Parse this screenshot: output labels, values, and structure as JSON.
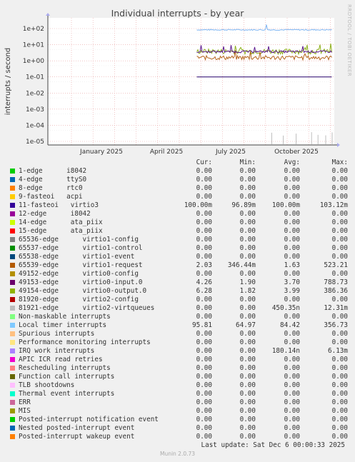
{
  "chart_data": {
    "type": "line",
    "title": "Individual interrupts - by year",
    "ylabel": "interrupts / second",
    "yscale": "log",
    "ylim": [
      1e-05,
      200
    ],
    "y_ticks": [
      "1e+02",
      "1e+01",
      "1e+00",
      "1e-01",
      "1e-02",
      "1e-03",
      "1e-04",
      "1e-05"
    ],
    "x_ticks": [
      "January 2025",
      "April 2025",
      "July 2025",
      "October 2025"
    ],
    "grid": true,
    "series": [
      {
        "name": "Local timer interrupts",
        "color": "#7eb5f2",
        "level": 84,
        "jitter": 0.08,
        "start": 0.52
      },
      {
        "name": "virtio0-output.0",
        "color": "#8db01b",
        "level": 4.0,
        "jitter": 0.35,
        "start": 0.52
      },
      {
        "name": "virtio1-request",
        "color": "#b5651d",
        "level": 1.6,
        "jitter": 0.3,
        "start": 0.52
      },
      {
        "name": "virtio0-input.0",
        "color": "#5c1a8c",
        "level": 3.7,
        "jitter": 0.15,
        "start": 0.52
      },
      {
        "name": "virtio3",
        "color": "#24006d",
        "level": 0.1,
        "jitter": 0.0,
        "start": 0.52
      }
    ],
    "spikes": [
      0.63,
      0.72,
      0.82,
      0.94,
      0.99,
      1.05,
      1.1,
      1.12
    ]
  },
  "side_label": "RRDTOOL / TOBI OETIKER",
  "legend": {
    "headers": {
      "cur": "Cur:",
      "min": "Min:",
      "avg": "Avg:",
      "max": "Max:"
    },
    "rows": [
      {
        "label": "1-edge      i8042",
        "color": "#00cc00",
        "cur": "0.00",
        "min": "0.00",
        "avg": "0.00",
        "max": "0.00"
      },
      {
        "label": "4-edge      ttyS0",
        "color": "#0066b3",
        "cur": "0.00",
        "min": "0.00",
        "avg": "0.00",
        "max": "0.00"
      },
      {
        "label": "8-edge      rtc0",
        "color": "#ff8000",
        "cur": "0.00",
        "min": "0.00",
        "avg": "0.00",
        "max": "0.00"
      },
      {
        "label": "9-fasteoi   acpi",
        "color": "#ffcc00",
        "cur": "0.00",
        "min": "0.00",
        "avg": "0.00",
        "max": "0.00"
      },
      {
        "label": "11-fasteoi   virtio3",
        "color": "#330099",
        "cur": "100.00m",
        "min": "96.89m",
        "avg": "100.00m",
        "max": "103.12m"
      },
      {
        "label": "12-edge      i8042",
        "color": "#990099",
        "cur": "0.00",
        "min": "0.00",
        "avg": "0.00",
        "max": "0.00"
      },
      {
        "label": "14-edge      ata_piix",
        "color": "#ccff00",
        "cur": "0.00",
        "min": "0.00",
        "avg": "0.00",
        "max": "0.00"
      },
      {
        "label": "15-edge      ata_piix",
        "color": "#ff0000",
        "cur": "0.00",
        "min": "0.00",
        "avg": "0.00",
        "max": "0.00"
      },
      {
        "label": "65536-edge      virtio1-config",
        "color": "#808080",
        "cur": "0.00",
        "min": "0.00",
        "avg": "0.00",
        "max": "0.00"
      },
      {
        "label": "65537-edge      virtio1-control",
        "color": "#008f00",
        "cur": "0.00",
        "min": "0.00",
        "avg": "0.00",
        "max": "0.00"
      },
      {
        "label": "65538-edge      virtio1-event",
        "color": "#00487d",
        "cur": "0.00",
        "min": "0.00",
        "avg": "0.00",
        "max": "0.00"
      },
      {
        "label": "65539-edge      virtio1-request",
        "color": "#b35a00",
        "cur": "2.03",
        "min": "346.44m",
        "avg": "1.63",
        "max": "523.21"
      },
      {
        "label": "49152-edge      virtio0-config",
        "color": "#b38f00",
        "cur": "0.00",
        "min": "0.00",
        "avg": "0.00",
        "max": "0.00"
      },
      {
        "label": "49153-edge      virtio0-input.0",
        "color": "#6b006b",
        "cur": "4.26",
        "min": "1.90",
        "avg": "3.70",
        "max": "788.73"
      },
      {
        "label": "49154-edge      virtio0-output.0",
        "color": "#8fb300",
        "cur": "6.28",
        "min": "1.82",
        "avg": "3.99",
        "max": "386.36"
      },
      {
        "label": "81920-edge      virtio2-config",
        "color": "#b30000",
        "cur": "0.00",
        "min": "0.00",
        "avg": "0.00",
        "max": "0.00"
      },
      {
        "label": "81921-edge      virtio2-virtqueues",
        "color": "#bebebe",
        "cur": "0.00",
        "min": "0.00",
        "avg": "450.35n",
        "max": "12.31m"
      },
      {
        "label": "Non-maskable interrupts",
        "color": "#80ff80",
        "cur": "0.00",
        "min": "0.00",
        "avg": "0.00",
        "max": "0.00"
      },
      {
        "label": "Local timer interrupts",
        "color": "#80c9ff",
        "cur": "95.81",
        "min": "64.97",
        "avg": "84.42",
        "max": "356.73"
      },
      {
        "label": "Spurious interrupts",
        "color": "#ffc080",
        "cur": "0.00",
        "min": "0.00",
        "avg": "0.00",
        "max": "0.00"
      },
      {
        "label": "Performance monitoring interrupts",
        "color": "#ffe680",
        "cur": "0.00",
        "min": "0.00",
        "avg": "0.00",
        "max": "0.00"
      },
      {
        "label": "IRQ work interrupts",
        "color": "#aa80ff",
        "cur": "0.00",
        "min": "0.00",
        "avg": "180.14n",
        "max": "6.13m"
      },
      {
        "label": "APIC ICR read retries",
        "color": "#ee00cc",
        "cur": "0.00",
        "min": "0.00",
        "avg": "0.00",
        "max": "0.00"
      },
      {
        "label": "Rescheduling interrupts",
        "color": "#ff8080",
        "cur": "0.00",
        "min": "0.00",
        "avg": "0.00",
        "max": "0.00"
      },
      {
        "label": "Function call interrupts",
        "color": "#666600",
        "cur": "0.00",
        "min": "0.00",
        "avg": "0.00",
        "max": "0.00"
      },
      {
        "label": "TLB shootdowns",
        "color": "#ffbfff",
        "cur": "0.00",
        "min": "0.00",
        "avg": "0.00",
        "max": "0.00"
      },
      {
        "label": "Thermal event interrupts",
        "color": "#00ffcc",
        "cur": "0.00",
        "min": "0.00",
        "avg": "0.00",
        "max": "0.00"
      },
      {
        "label": "ERR",
        "color": "#cc6699",
        "cur": "0.00",
        "min": "0.00",
        "avg": "0.00",
        "max": "0.00"
      },
      {
        "label": "MIS",
        "color": "#999900",
        "cur": "0.00",
        "min": "0.00",
        "avg": "0.00",
        "max": "0.00"
      },
      {
        "label": "Posted-interrupt notification event",
        "color": "#00cc00",
        "cur": "0.00",
        "min": "0.00",
        "avg": "0.00",
        "max": "0.00"
      },
      {
        "label": "Nested posted-interrupt event",
        "color": "#0066b3",
        "cur": "0.00",
        "min": "0.00",
        "avg": "0.00",
        "max": "0.00"
      },
      {
        "label": "Posted-interrupt wakeup event",
        "color": "#ff8000",
        "cur": "0.00",
        "min": "0.00",
        "avg": "0.00",
        "max": "0.00"
      }
    ]
  },
  "last_update": "Last update: Sat Dec  6 00:00:33 2025",
  "footer": "Munin 2.0.73"
}
